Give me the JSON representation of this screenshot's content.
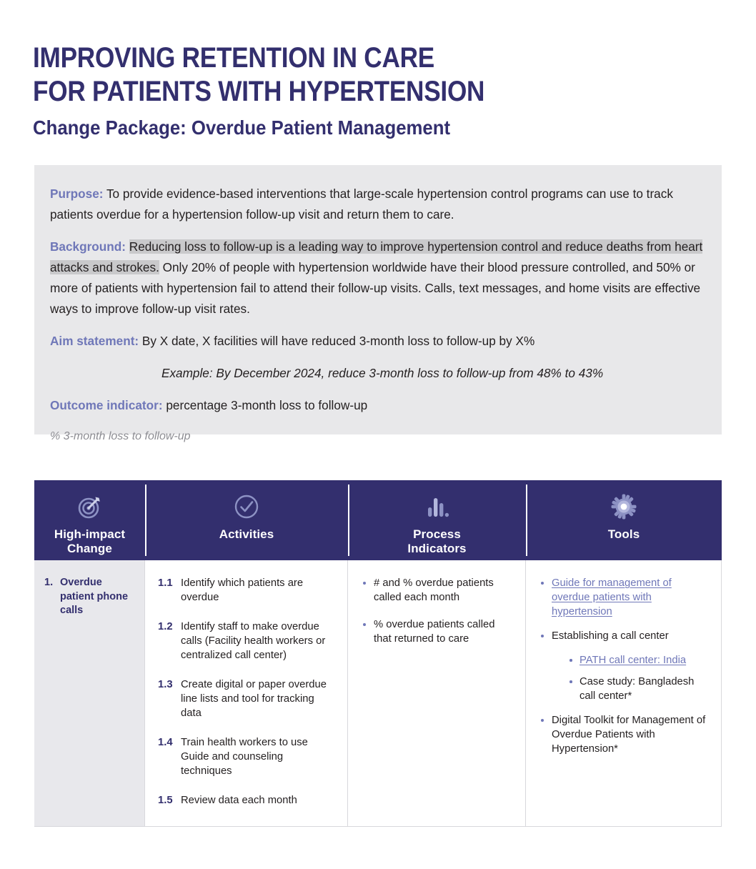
{
  "title": {
    "line1": "IMPROVING RETENTION IN CARE",
    "line2": "FOR PATIENTS WITH HYPERTENSION",
    "subtitle": "Change Package: Overdue Patient Management"
  },
  "info_panel": {
    "purpose_label": "Purpose:",
    "purpose_text": " To provide evidence-based interventions that large-scale hypertension control programs can use to track patients overdue for a hypertension follow-up visit and return them to care.",
    "background_label": "Background:",
    "background_highlight": "Reducing loss to follow-up is a leading way to improve hypertension control and reduce deaths from heart attacks and strokes.",
    "background_rest": " Only 20% of people with hypertension worldwide have their blood pressure controlled, and 50% or more of patients with hypertension fail to attend their follow-up visits. Calls, text messages, and home visits are effective ways to improve follow-up visit rates.",
    "aim_label": "Aim statement:",
    "aim_text": " By X date, X facilities will have reduced 3-month loss to follow-up by X%",
    "example_text": "Example: By December 2024, reduce 3-month loss to follow-up from 48% to 43%",
    "outcome_label": "Outcome indicator:",
    "outcome_text": " percentage 3-month loss to follow-up",
    "footnote": "% 3-month loss to follow-up"
  },
  "table": {
    "headers": [
      {
        "label": "High-impact\nChange",
        "icon": "target-icon"
      },
      {
        "label": "Activities",
        "icon": "check-circle-icon"
      },
      {
        "label": "Process\nIndicators",
        "icon": "bar-chart-icon"
      },
      {
        "label": "Tools",
        "icon": "gear-icon"
      }
    ],
    "header_labels": {
      "high_impact_change_l1": "High-impact",
      "high_impact_change_l2": "Change",
      "activities": "Activities",
      "process_indicators_l1": "Process",
      "process_indicators_l2": "Indicators",
      "tools": "Tools"
    },
    "row": {
      "high_impact_change": {
        "number": "1.",
        "text": "Overdue patient phone calls"
      },
      "activities": [
        {
          "number": "1.1",
          "text": "Identify which patients are overdue"
        },
        {
          "number": "1.2",
          "text": "Identify staff to make overdue calls (Facility health workers or centralized call center)"
        },
        {
          "number": "1.3",
          "text": "Create digital or paper overdue line lists and tool for tracking data"
        },
        {
          "number": "1.4",
          "text": "Train health workers to use Guide and counseling techniques"
        },
        {
          "number": "1.5",
          "text": "Review data each month"
        }
      ],
      "process_indicators": [
        "# and % overdue patients called each month",
        "% overdue patients called that returned to care"
      ],
      "tools": [
        {
          "text": "Guide for management of overdue patients with hypertension ",
          "link": true,
          "children": []
        },
        {
          "text": "Establishing a call center",
          "link": false,
          "children": [
            {
              "text": "PATH call center: India",
              "link": true
            },
            {
              "text": "Case study: Bangladesh call center*",
              "link": false
            }
          ]
        },
        {
          "text": "Digital Toolkit for Management of Overdue Patients with Hypertension*",
          "link": false,
          "children": []
        }
      ]
    }
  },
  "colors": {
    "navy": "#332f6e",
    "periwinkle": "#6f77b8",
    "panel_bg": "#e8e8ea",
    "highlight": "#c9c9cb",
    "cell_bg": "#e8e8ec",
    "body_text": "#231f20",
    "footnote": "#8d8d93"
  }
}
